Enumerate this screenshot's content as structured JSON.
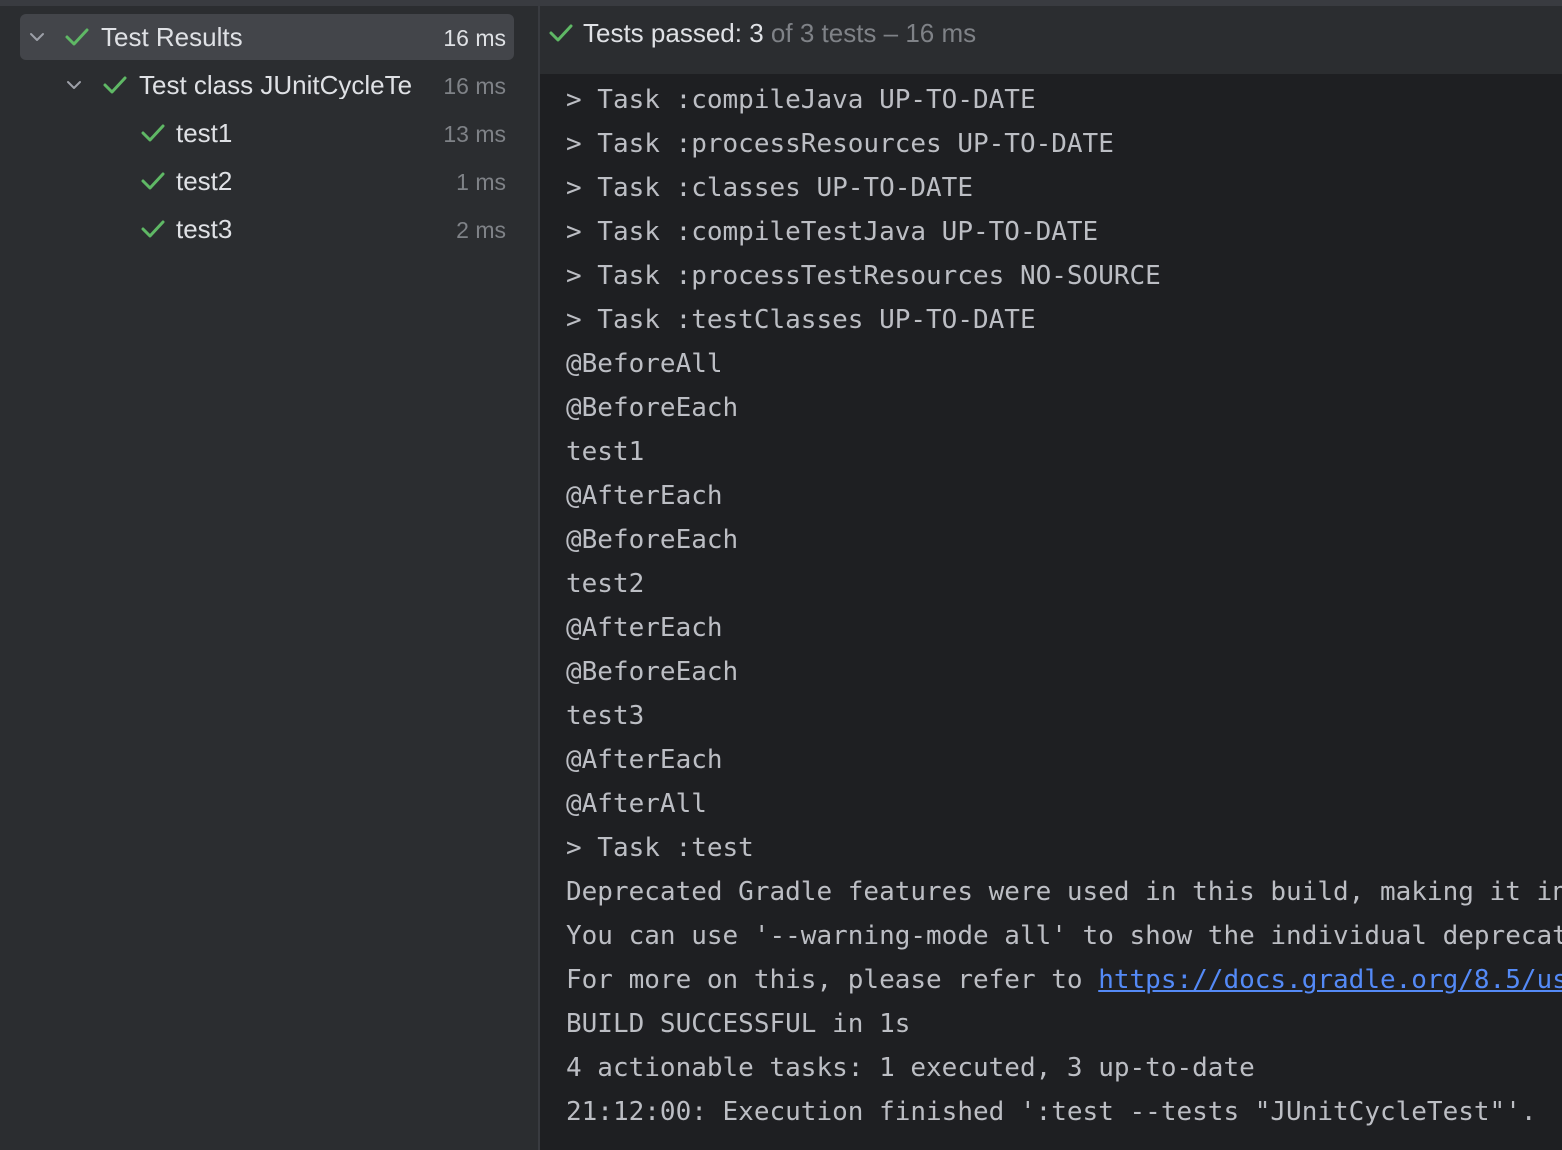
{
  "tree": {
    "rows": [
      {
        "name": "Test Results",
        "time": "16 ms"
      },
      {
        "name": "Test class JUnitCycleTe",
        "time": "16 ms"
      },
      {
        "name": "test1",
        "time": "13 ms"
      },
      {
        "name": "test2",
        "time": "1 ms"
      },
      {
        "name": "test3",
        "time": "2 ms"
      }
    ]
  },
  "header": {
    "passed_label": "Tests passed:",
    "passed_count": "3",
    "rest": "of 3 tests – 16 ms"
  },
  "console": {
    "lines": [
      "> Task :compileJava UP-TO-DATE",
      "> Task :processResources UP-TO-DATE",
      "> Task :classes UP-TO-DATE",
      "> Task :compileTestJava UP-TO-DATE",
      "> Task :processTestResources NO-SOURCE",
      "> Task :testClasses UP-TO-DATE",
      "@BeforeAll",
      "@BeforeEach",
      "test1",
      "@AfterEach",
      "@BeforeEach",
      "test2",
      "@AfterEach",
      "@BeforeEach",
      "test3",
      "@AfterEach",
      "@AfterAll",
      "> Task :test",
      "Deprecated Gradle features were used in this build, making it in",
      "You can use '--warning-mode all' to show the individual deprecat",
      "For more on this, please refer to ",
      "BUILD SUCCESSFUL in 1s",
      "4 actionable tasks: 1 executed, 3 up-to-date",
      "21:12:00: Execution finished ':test --tests \"JUnitCycleTest\"'."
    ],
    "link_text": "https://docs.gradle.org/8.5/us"
  },
  "colors": {
    "check": "#5fb865",
    "link": "#548af7"
  }
}
